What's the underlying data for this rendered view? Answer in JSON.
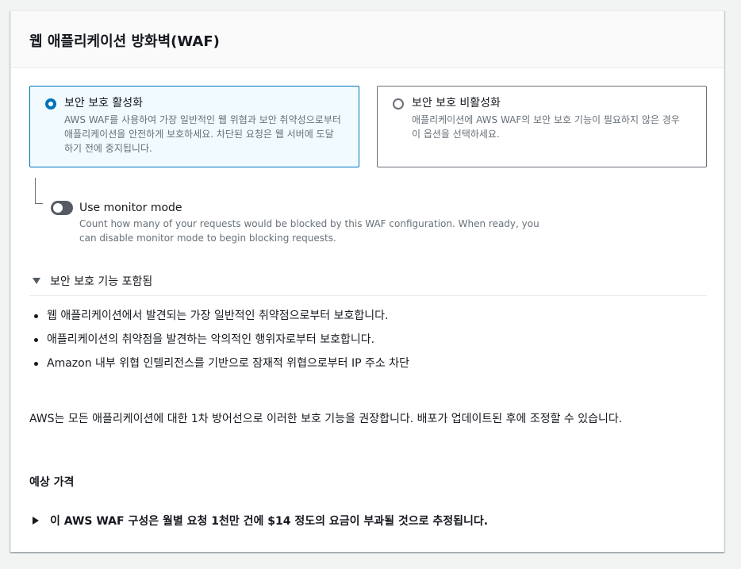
{
  "panel": {
    "title": "웹 애플리케이션 방화벽(WAF)"
  },
  "options": [
    {
      "label": "보안 보호 활성화",
      "description": "AWS WAF를 사용하여 가장 일반적인 웹 위협과 보안 취약성으로부터 애플리케이션을 안전하게 보호하세요. 차단된 요청은 웹 서버에 도달하기 전에 중지됩니다.",
      "selected": true
    },
    {
      "label": "보안 보호 비활성화",
      "description": "애플리케이션에 AWS WAF의 보안 보호 기능이 필요하지 않은 경우 이 옵션을 선택하세요.",
      "selected": false
    }
  ],
  "monitor": {
    "label": "Use monitor mode",
    "description": "Count how many of your requests would be blocked by this WAF configuration. When ready, you can disable monitor mode to begin blocking requests.",
    "enabled": false
  },
  "included": {
    "label": "보안 보호 기능 포함됨",
    "expanded": true,
    "items": [
      "웹 애플리케이션에서 발견되는 가장 일반적인 취약점으로부터 보호합니다.",
      "애플리케이션의 취약점을 발견하는 악의적인 행위자로부터 보호합니다.",
      "Amazon 내부 위협 인텔리전스를 기반으로 잠재적 위협으로부터 IP 주소 차단"
    ]
  },
  "recommendation": "AWS는 모든 애플리케이션에 대한 1차 방어선으로 이러한 보호 기능을 권장합니다. 배포가 업데이트된 후에 조정할 수 있습니다.",
  "pricing": {
    "heading": "예상 가격",
    "estimate": "이 AWS WAF 구성은 월별 요청 1천만 건에 $14 정도의 요금이 부과될 것으로 추정됩니다.",
    "expanded": false
  },
  "colors": {
    "accent": "#0073bb",
    "selected_bg": "#f1faff",
    "muted_text": "#687078"
  }
}
